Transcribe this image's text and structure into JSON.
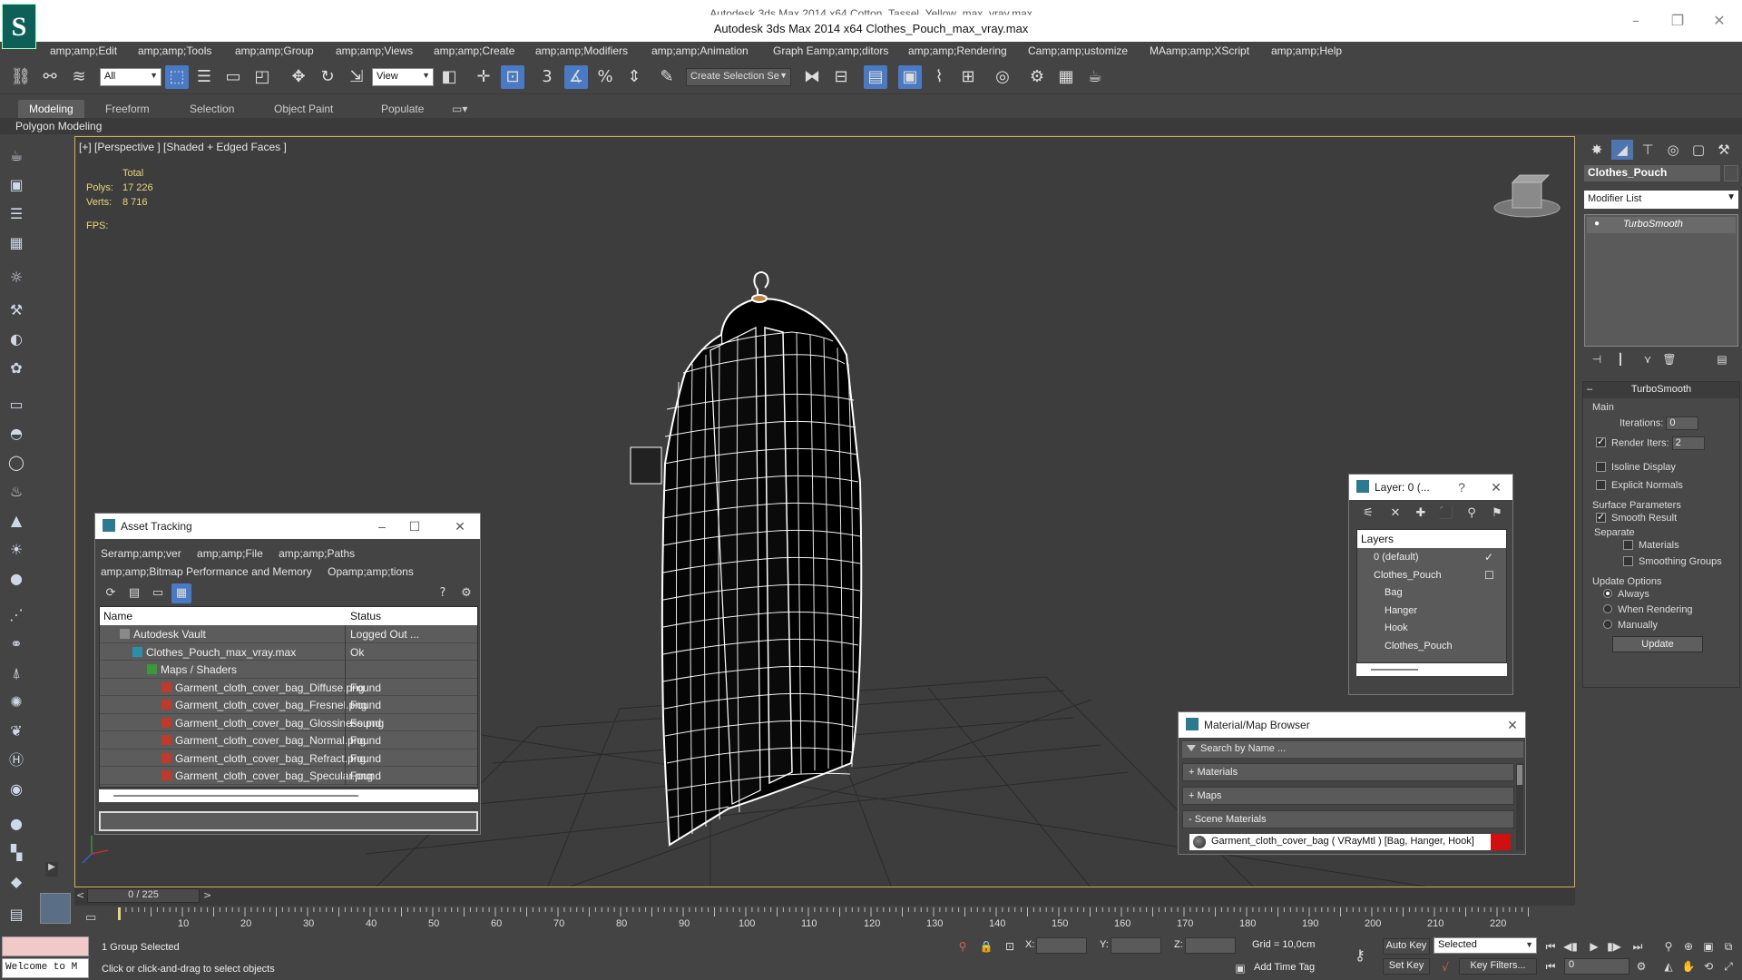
{
  "window": {
    "title_ghost": "Autodesk 3ds Max  2014 x64      Cotton_Tassel_Yellow_max_vray.max",
    "title": "Autodesk 3ds Max  2014 x64      Clothes_Pouch_max_vray.max",
    "logo_letter": "S",
    "minimize_icon": "minimize-icon",
    "restore_icon": "restore-icon",
    "close_icon": "close-icon"
  },
  "menubar": {
    "items": [
      "amp;amp;Edit",
      "amp;amp;Tools",
      "amp;amp;Group",
      "amp;amp;Views",
      "amp;amp;Create",
      "amp;amp;Modifiers",
      "amp;amp;Animation",
      "Graph Eamp;amp;ditors",
      "amp;amp;Rendering",
      "Camp;amp;ustomize",
      "MAamp;amp;XScript",
      "amp;amp;Help"
    ]
  },
  "toolbar": {
    "selection_filter": "All",
    "ref_coord": "View",
    "named_selection_placeholder": "Create Selection Se"
  },
  "ribbon": {
    "tabs": [
      "Modeling",
      "Freeform",
      "Selection",
      "Object Paint",
      "Populate"
    ],
    "active_tab": "Modeling",
    "subtitle": "Polygon Modeling"
  },
  "viewport": {
    "label": "[+] [Perspective ] [Shaded + Edged Faces ]",
    "stats": {
      "total_label": "Total",
      "polys_label": "Polys:",
      "polys_value": "17 226",
      "verts_label": "Verts:",
      "verts_value": "8 716",
      "fps_label": "FPS:"
    }
  },
  "asset_tracking": {
    "title": "Asset Tracking",
    "menus": [
      "Seramp;amp;ver",
      "amp;amp;File",
      "amp;amp;Paths",
      "amp;amp;Bitmap Performance and Memory",
      "Opamp;amp;tions"
    ],
    "columns": {
      "name": "Name",
      "status": "Status"
    },
    "rows": [
      {
        "name": "Autodesk Vault",
        "status": "Logged Out ...",
        "indent": 1
      },
      {
        "name": "Clothes_Pouch_max_vray.max",
        "status": "Ok",
        "indent": 2
      },
      {
        "name": "Maps / Shaders",
        "status": "",
        "indent": 3
      },
      {
        "name": "Garment_cloth_cover_bag_Diffuse.png",
        "status": "Found",
        "indent": 4
      },
      {
        "name": "Garment_cloth_cover_bag_Fresnel.png",
        "status": "Found",
        "indent": 4
      },
      {
        "name": "Garment_cloth_cover_bag_Glossiness.png",
        "status": "Found",
        "indent": 4
      },
      {
        "name": "Garment_cloth_cover_bag_Normal.png",
        "status": "Found",
        "indent": 4
      },
      {
        "name": "Garment_cloth_cover_bag_Refract.png",
        "status": "Found",
        "indent": 4
      },
      {
        "name": "Garment_cloth_cover_bag_Specular.png",
        "status": "Found",
        "indent": 4
      }
    ]
  },
  "layer_panel": {
    "title": "Layer: 0 (...",
    "help": "?",
    "header": "Layers",
    "rows": [
      {
        "name": "0 (default)",
        "mark": "✓",
        "level": 1
      },
      {
        "name": "Clothes_Pouch",
        "mark": "☐",
        "level": 1
      },
      {
        "name": "Bag",
        "mark": "",
        "level": 2
      },
      {
        "name": "Hanger",
        "mark": "",
        "level": 2
      },
      {
        "name": "Hook",
        "mark": "",
        "level": 2
      },
      {
        "name": "Clothes_Pouch",
        "mark": "",
        "level": 2
      }
    ]
  },
  "material_browser": {
    "title": "Material/Map Browser",
    "search_placeholder": "Search by Name ...",
    "groups": [
      "+ Materials",
      "+ Maps",
      "- Scene Materials"
    ],
    "item": "Garment_cloth_cover_bag  ( VRayMtl ) [Bag, Hanger, Hook]"
  },
  "command_panel": {
    "object_name": "Clothes_Pouch",
    "modifier_list": "Modifier List",
    "stack": [
      "TurboSmooth"
    ],
    "rollout_title": "TurboSmooth",
    "main_label": "Main",
    "iterations_label": "Iterations:",
    "iterations_value": "0",
    "render_iters_label": "Render Iters:",
    "render_iters_value": "2",
    "render_iters_checked": true,
    "isoline_label": "Isoline Display",
    "explicit_normals_label": "Explicit Normals",
    "surface_params_label": "Surface Parameters",
    "smooth_result_label": "Smooth Result",
    "separate_label": "Separate",
    "materials_label": "Materials",
    "smoothing_groups_label": "Smoothing Groups",
    "update_options_label": "Update Options",
    "radio_always": "Always",
    "radio_when_rendering": "When Rendering",
    "radio_manually": "Manually",
    "update_button": "Update"
  },
  "timeline": {
    "frame_readout": "0 / 225",
    "ticks": [
      "10",
      "20",
      "30",
      "40",
      "50",
      "60",
      "70",
      "80",
      "90",
      "100",
      "110",
      "120",
      "130",
      "140",
      "150",
      "160",
      "170",
      "180",
      "190",
      "200",
      "210",
      "220"
    ]
  },
  "statusbar": {
    "maxscript_text": "Welcome to M",
    "selection_status": "1 Group Selected",
    "prompt": "Click or click-and-drag to select objects",
    "x_label": "X:",
    "y_label": "Y:",
    "z_label": "Z:",
    "grid": "Grid = 10,0cm",
    "add_time_tag": "Add Time Tag",
    "auto_key": "Auto Key",
    "set_key": "Set Key",
    "key_mode": "Selected",
    "key_filters": "Key Filters...",
    "current_frame": "0"
  },
  "colors": {
    "viewport_border": "#cfb44a",
    "stats_text": "#e8d77a",
    "active_blue": "#4a7ac4",
    "wire": "#ffffff"
  }
}
